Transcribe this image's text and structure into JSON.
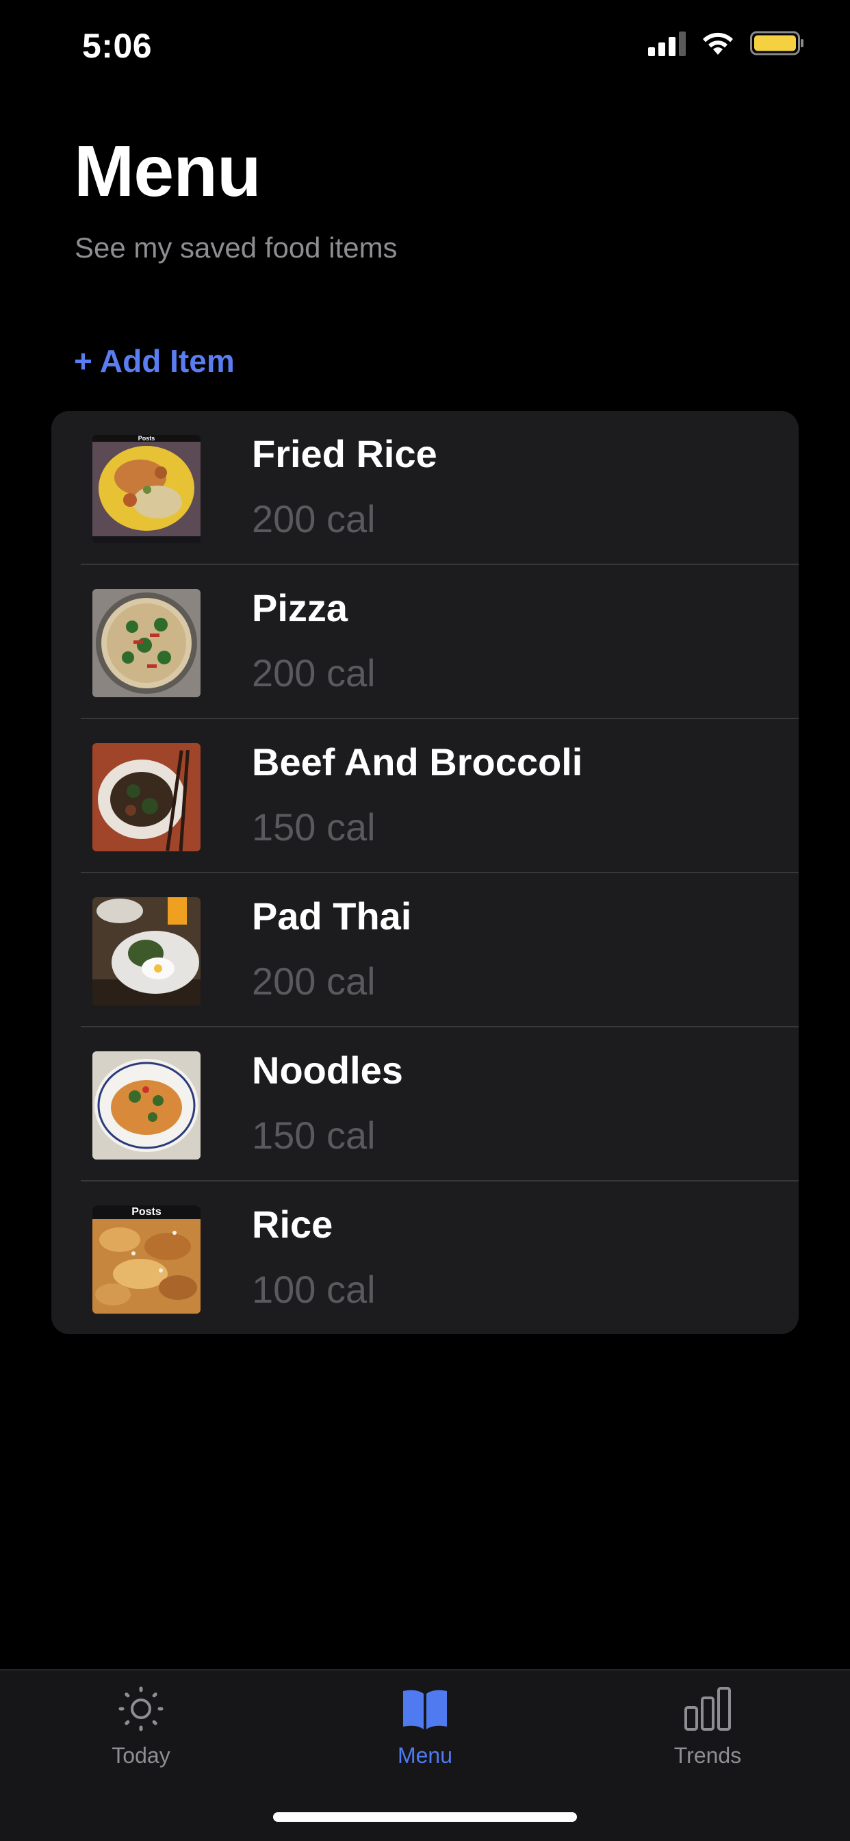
{
  "status_bar": {
    "time": "5:06"
  },
  "header": {
    "title": "Menu",
    "subtitle": "See my saved food items"
  },
  "add_item_label": "+ Add Item",
  "food_items": [
    {
      "name": "Fried Rice",
      "calories": "200 cal",
      "thumb_caption": "Posts"
    },
    {
      "name": "Pizza",
      "calories": "200 cal"
    },
    {
      "name": "Beef And Broccoli",
      "calories": "150 cal"
    },
    {
      "name": "Pad Thai",
      "calories": "200 cal"
    },
    {
      "name": "Noodles",
      "calories": "150 cal"
    },
    {
      "name": "Rice",
      "calories": "100 cal",
      "thumb_caption": "Posts"
    }
  ],
  "tab_bar": {
    "tabs": [
      {
        "label": "Today",
        "icon": "sun-icon",
        "active": false
      },
      {
        "label": "Menu",
        "icon": "book-icon",
        "active": true
      },
      {
        "label": "Trends",
        "icon": "bar-chart-icon",
        "active": false
      }
    ]
  },
  "colors": {
    "accent": "#5a7ef1",
    "background": "#000000",
    "card": "#1c1c1e",
    "secondary_text": "#8d8d92",
    "battery": "#f5d142"
  }
}
